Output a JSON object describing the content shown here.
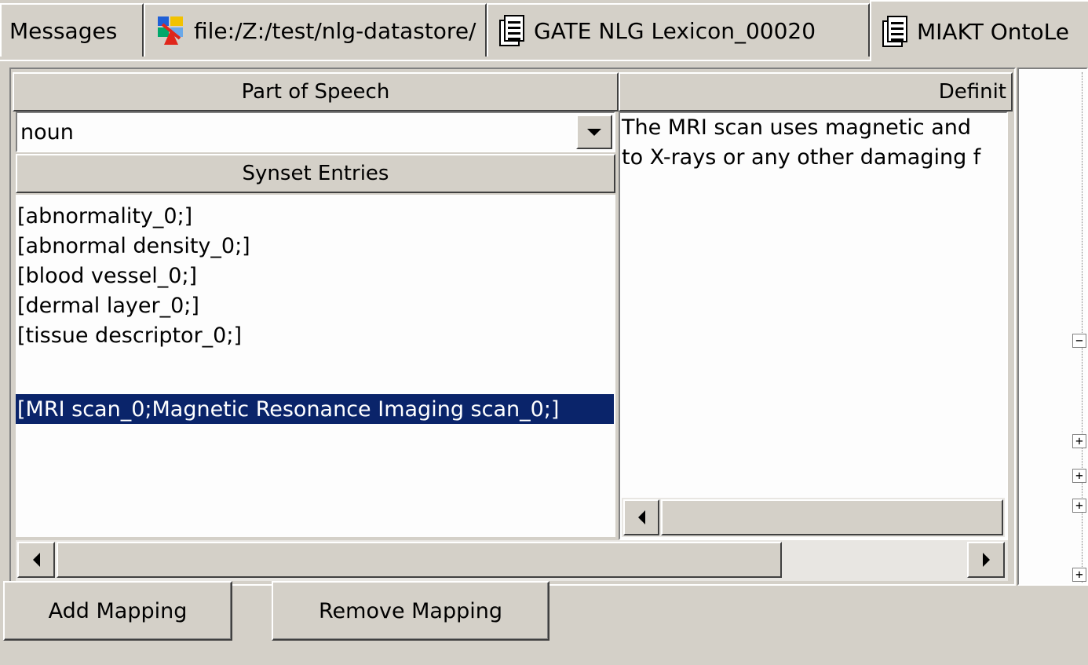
{
  "tabs": [
    {
      "label": "Messages",
      "icon": null
    },
    {
      "label": "file:/Z:/test/nlg-datastore/",
      "icon": "datastore-icon"
    },
    {
      "label": "GATE NLG Lexicon_00020",
      "icon": "document-icon"
    },
    {
      "label": "MIAKT OntoLe",
      "icon": "document-icon"
    }
  ],
  "left_panel": {
    "pos_header": "Part of Speech",
    "pos_value": "noun",
    "synset_header": "Synset Entries",
    "synsets": [
      "[abnormality_0;]",
      "[abnormal density_0;]",
      "[blood vessel_0;]",
      "[dermal layer_0;]",
      "[tissue descriptor_0;]",
      "[MRI scan_0;Magnetic Resonance Imaging scan_0;]"
    ],
    "selected_index": 5
  },
  "definition_panel": {
    "header": "Definit",
    "lines": [
      "The MRI scan uses magnetic and",
      "to X-rays or any other damaging f"
    ]
  },
  "tree_nodes": [
    "collapse",
    "expand",
    "expand",
    "expand",
    "expand"
  ],
  "buttons": {
    "add_mapping": "Add Mapping",
    "remove_mapping": "Remove Mapping"
  },
  "colors": {
    "window_bg": "#d4d0c8",
    "selection_bg": "#0a246a",
    "selection_fg": "#ffffff"
  }
}
